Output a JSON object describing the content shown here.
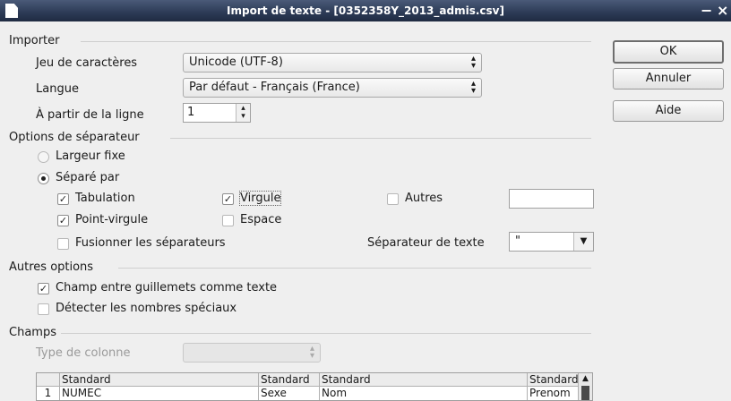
{
  "window": {
    "title": "Import de texte - [0352358Y_2013_admis.csv]",
    "minimize": "−",
    "close": "×"
  },
  "importer": {
    "section": "Importer",
    "charset_label": "Jeu de caractères",
    "charset_value": "Unicode (UTF-8)",
    "language_label": "Langue",
    "language_value": "Par défaut - Français (France)",
    "from_line_label": "À partir de la ligne",
    "from_line_value": "1"
  },
  "separator": {
    "section": "Options de séparateur",
    "fixed_width": "Largeur fixe",
    "separated_by": "Séparé par",
    "tab": "Tabulation",
    "comma": "Virgule",
    "other": "Autres",
    "semicolon": "Point-virgule",
    "space": "Espace",
    "merge": "Fusionner les séparateurs",
    "text_delim_label": "Séparateur de texte",
    "text_delim_value": "\""
  },
  "other_options": {
    "section": "Autres options",
    "quoted_as_text": "Champ entre guillemets comme texte",
    "detect_special": "Détecter les nombres spéciaux"
  },
  "fields": {
    "section": "Champs",
    "column_type_label": "Type de colonne",
    "headers": [
      "Standard",
      "Standard",
      "Standard",
      "Standard"
    ],
    "row_number": "1",
    "row": [
      "NUMEC",
      "Sexe",
      "Nom",
      "Prenom"
    ]
  },
  "buttons": {
    "ok": "OK",
    "cancel": "Annuler",
    "help": "Aide"
  },
  "icons": {
    "spin": "spin-arrows-icon",
    "dropdown": "chevron-down-icon",
    "check": "checkmark-icon"
  }
}
